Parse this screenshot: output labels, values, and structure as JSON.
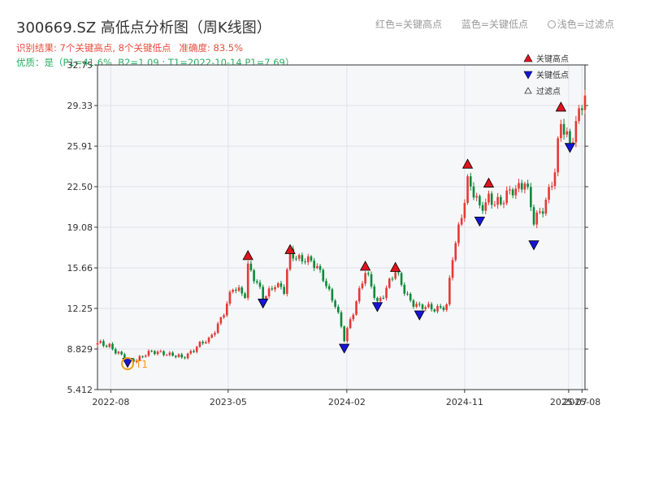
{
  "header": {
    "title": "300669.SZ 高低点分析图（周K线图）",
    "result_peaks": "识别结果: 7个关键高点, 8个关键低点",
    "accuracy": "准确度: 83.5%",
    "quality": "优质：是（P1=41.6%, B2=1.09 ; T1=2022-10-14 P1=7.69）"
  },
  "top_legend": {
    "red": "红色=关键高点",
    "blue": "蓝色=关键低点",
    "light": "浅色=过滤点"
  },
  "colors": {
    "up": "#e53935",
    "down": "#0a8a3a",
    "peak": "#e0141e",
    "trough": "#1515d8",
    "t1": "#f39c12",
    "plot_bg": "#f6f7f9"
  },
  "chart_data": {
    "type": "candlestick",
    "title": "300669.SZ 高低点分析图（周K线图）",
    "xlabel": "",
    "ylabel": "",
    "ylim": [
      5.412,
      32.75
    ],
    "xlim": [
      "2022-07-01",
      "2025-08-08"
    ],
    "y_ticks": [
      "5.412",
      "8.829",
      "12.25",
      "15.66",
      "19.08",
      "22.50",
      "25.91",
      "29.33",
      "32.75"
    ],
    "x_ticks": [
      "2022-08",
      "2023-05",
      "2024-02",
      "2024-11",
      "2025-07",
      "2025-08"
    ],
    "grid": true,
    "legend": [
      "关键高点",
      "关键低点",
      "过滤点"
    ],
    "legend_position": "top-right",
    "key_highs": [
      {
        "date": "2023-06-16",
        "price": 16.7
      },
      {
        "date": "2023-09-22",
        "price": 17.2
      },
      {
        "date": "2024-03-15",
        "price": 15.8
      },
      {
        "date": "2024-05-24",
        "price": 15.7
      },
      {
        "date": "2024-11-08",
        "price": 24.4
      },
      {
        "date": "2024-12-27",
        "price": 22.8
      },
      {
        "date": "2025-06-13",
        "price": 29.2
      }
    ],
    "key_lows": [
      {
        "date": "2022-09-09",
        "price": 7.7
      },
      {
        "date": "2023-07-21",
        "price": 12.7
      },
      {
        "date": "2024-01-26",
        "price": 8.9
      },
      {
        "date": "2024-04-12",
        "price": 12.4
      },
      {
        "date": "2024-07-19",
        "price": 11.7
      },
      {
        "date": "2024-12-06",
        "price": 19.6
      },
      {
        "date": "2025-04-11",
        "price": 17.6
      },
      {
        "date": "2025-07-04",
        "price": 25.8
      }
    ],
    "t1": {
      "label": "T1",
      "date": "2022-09-09",
      "price": 7.6
    },
    "anchors": [
      [
        "2022-07-01",
        9.2
      ],
      [
        "2022-07-29",
        9.2
      ],
      [
        "2022-09-09",
        7.7
      ],
      [
        "2022-10-21",
        8.4
      ],
      [
        "2022-12-02",
        8.6
      ],
      [
        "2023-01-13",
        8.0
      ],
      [
        "2023-02-17",
        9.1
      ],
      [
        "2023-03-17",
        9.5
      ],
      [
        "2023-04-21",
        12.0
      ],
      [
        "2023-05-12",
        13.8
      ],
      [
        "2023-06-09",
        13.6
      ],
      [
        "2023-06-16",
        16.0
      ],
      [
        "2023-07-21",
        13.0
      ],
      [
        "2023-08-18",
        14.5
      ],
      [
        "2023-09-08",
        13.6
      ],
      [
        "2023-09-22",
        16.8
      ],
      [
        "2023-10-27",
        16.5
      ],
      [
        "2023-12-08",
        15.0
      ],
      [
        "2024-01-05",
        12.5
      ],
      [
        "2024-01-26",
        9.6
      ],
      [
        "2024-02-23",
        13.0
      ],
      [
        "2024-03-15",
        15.2
      ],
      [
        "2024-04-12",
        12.8
      ],
      [
        "2024-05-24",
        15.2
      ],
      [
        "2024-06-28",
        13.0
      ],
      [
        "2024-07-19",
        12.2
      ],
      [
        "2024-08-16",
        12.4
      ],
      [
        "2024-09-20",
        12.3
      ],
      [
        "2024-10-04",
        16.5
      ],
      [
        "2024-11-08",
        23.0
      ],
      [
        "2024-12-06",
        20.5
      ],
      [
        "2024-12-27",
        21.8
      ],
      [
        "2025-01-24",
        20.8
      ],
      [
        "2025-02-21",
        22.5
      ],
      [
        "2025-03-21",
        22.8
      ],
      [
        "2025-04-11",
        19.5
      ],
      [
        "2025-05-09",
        21.5
      ],
      [
        "2025-05-30",
        23.5
      ],
      [
        "2025-06-13",
        27.8
      ],
      [
        "2025-07-04",
        26.5
      ],
      [
        "2025-08-08",
        29.8
      ]
    ]
  }
}
